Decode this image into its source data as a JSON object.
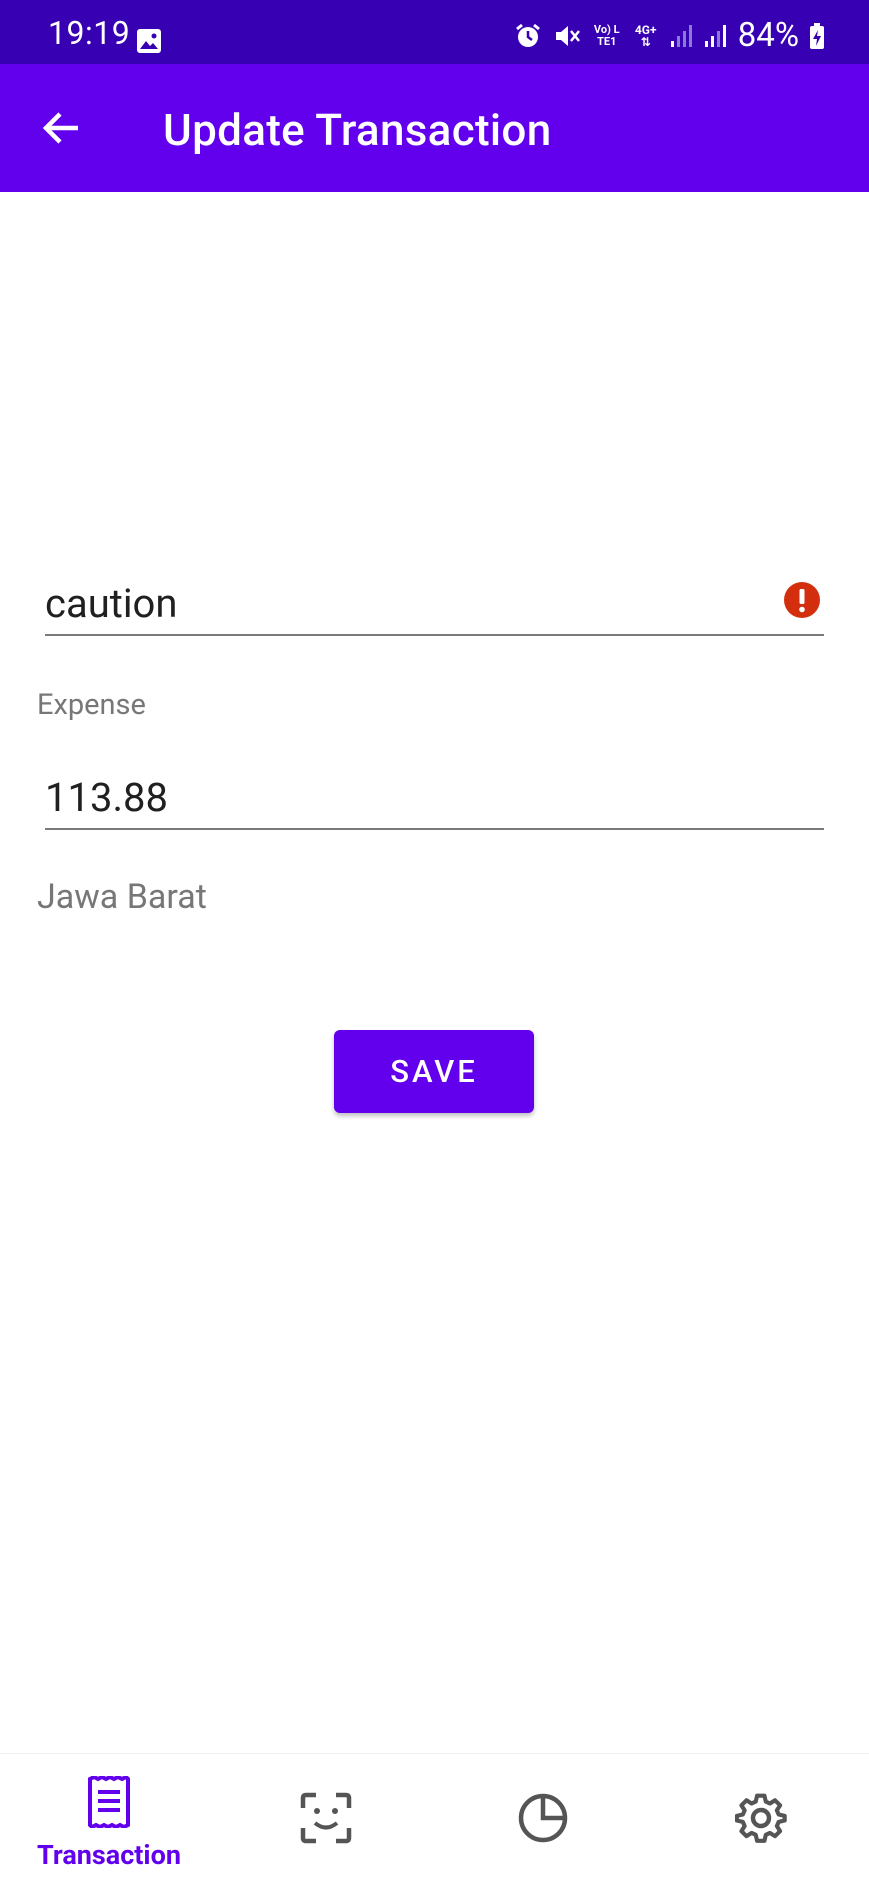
{
  "status_bar": {
    "time": "19:19",
    "battery": "84%",
    "network_volte": "Vo) LTE1",
    "network_4g": "4G+"
  },
  "app_bar": {
    "title": "Update Transaction"
  },
  "form": {
    "description_value": "caution",
    "type_label": "Expense",
    "amount_value": "113.88",
    "location_label": "Jawa Barat",
    "save_label": "SAVE"
  },
  "bottom_nav": {
    "items": [
      {
        "label": "Transaction",
        "icon": "receipt-icon",
        "active": true
      },
      {
        "label": "",
        "icon": "face-scan-icon",
        "active": false
      },
      {
        "label": "",
        "icon": "pie-chart-icon",
        "active": false
      },
      {
        "label": "",
        "icon": "gear-icon",
        "active": false
      }
    ]
  },
  "colors": {
    "status_bar": "#3700b3",
    "primary": "#6200ee",
    "error": "#d32f0f",
    "inactive_icon": "#555555"
  }
}
